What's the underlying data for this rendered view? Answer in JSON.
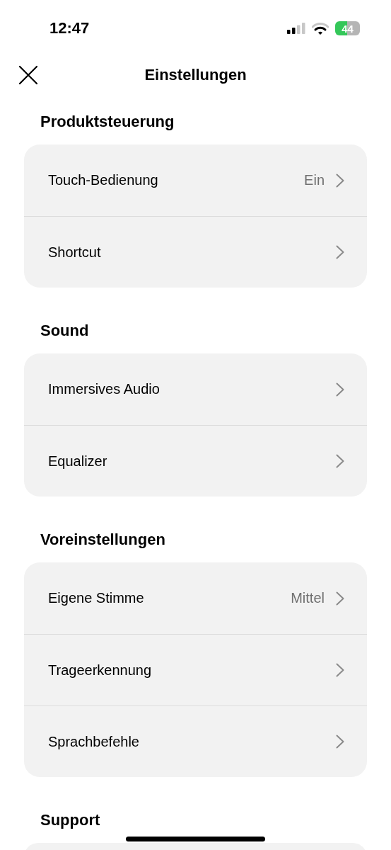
{
  "status_bar": {
    "time": "12:47",
    "battery": "44"
  },
  "header": {
    "title": "Einstellungen"
  },
  "sections": [
    {
      "title": "Produktsteuerung",
      "items": [
        {
          "label": "Touch-Bedienung",
          "value": "Ein"
        },
        {
          "label": "Shortcut"
        }
      ]
    },
    {
      "title": "Sound",
      "items": [
        {
          "label": "Immersives Audio"
        },
        {
          "label": "Equalizer"
        }
      ]
    },
    {
      "title": "Voreinstellungen",
      "items": [
        {
          "label": "Eigene Stimme",
          "value": "Mittel"
        },
        {
          "label": "Trageerkennung"
        },
        {
          "label": "Sprachbefehle"
        }
      ]
    },
    {
      "title": "Support"
    }
  ]
}
